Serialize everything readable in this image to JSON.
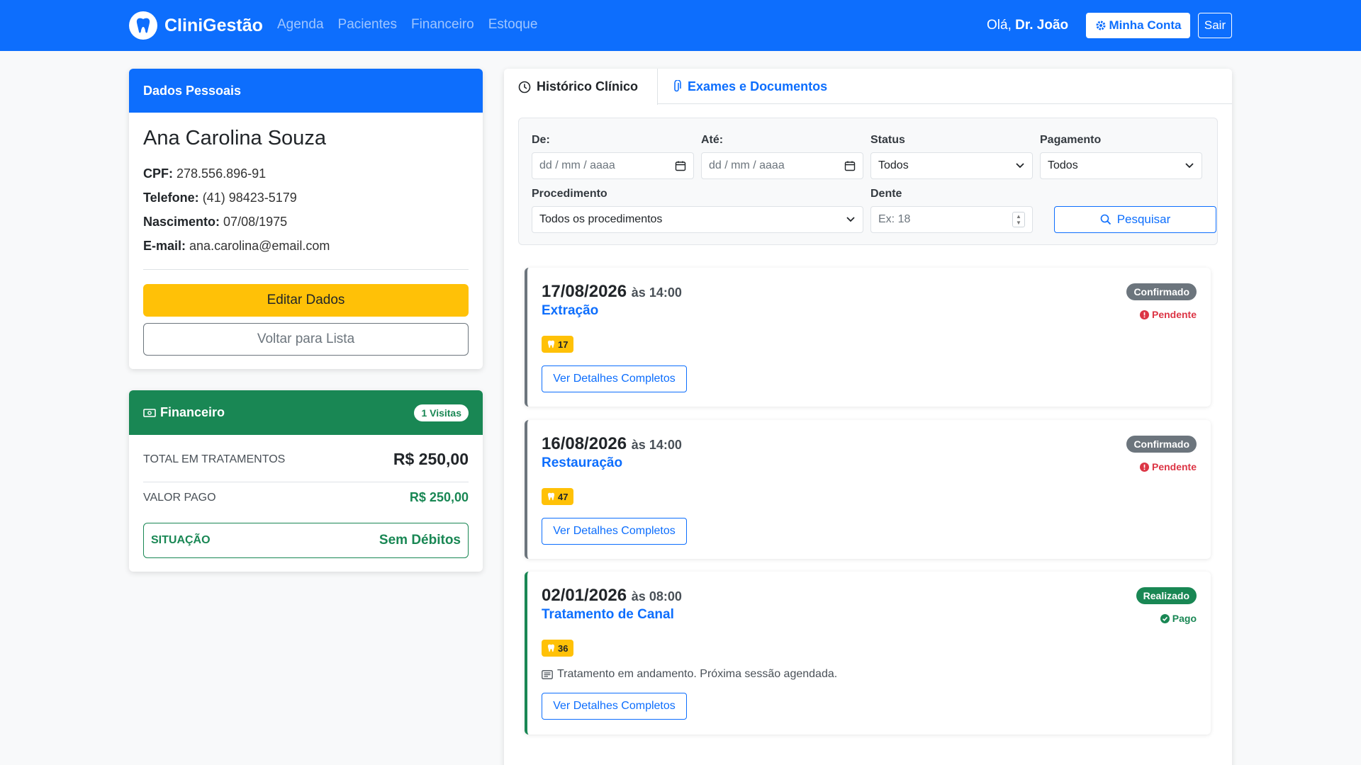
{
  "navbar": {
    "brand": "CliniGestão",
    "links": [
      "Agenda",
      "Pacientes",
      "Financeiro",
      "Estoque"
    ],
    "greeting_prefix": "Olá,",
    "user_name": "Dr. João",
    "account_label": "Minha Conta",
    "logout_label": "Sair",
    "brand_color": "#0d6efd"
  },
  "personal": {
    "header": "Dados Pessoais",
    "name": "Ana Carolina Souza",
    "cpf_label": "CPF:",
    "cpf": "278.556.896-91",
    "phone_label": "Telefone:",
    "phone": "(41) 98423-5179",
    "birth_label": "Nascimento:",
    "birth": "07/08/1975",
    "email_label": "E-mail:",
    "email": "ana.carolina@email.com",
    "edit_label": "Editar Dados",
    "back_label": "Voltar para Lista"
  },
  "finance": {
    "header": "Financeiro",
    "visits_badge": "1 Visitas",
    "total_label": "TOTAL EM TRATAMENTOS",
    "total_value": "R$ 250,00",
    "paid_label": "VALOR PAGO",
    "paid_value": "R$ 250,00",
    "situation_label": "SITUAÇÃO",
    "situation_value": "Sem Débitos",
    "color": "#198754"
  },
  "tabs": {
    "history": "Histórico Clínico",
    "exams": "Exames e Documentos"
  },
  "filters": {
    "from_label": "De:",
    "from_placeholder": "dd / mm / aaaa",
    "to_label": "Até:",
    "to_placeholder": "dd / mm / aaaa",
    "status_label": "Status",
    "status_value": "Todos",
    "payment_label": "Pagamento",
    "payment_value": "Todos",
    "procedure_label": "Procedimento",
    "procedure_value": "Todos os procedimentos",
    "tooth_label": "Dente",
    "tooth_placeholder": "Ex: 18",
    "search_label": "Pesquisar"
  },
  "appointments": [
    {
      "date": "17/08/2026",
      "time": "às 14:00",
      "procedure": "Extração",
      "tooth": "17",
      "status": "Confirmado",
      "payment": "Pendente",
      "details_label": "Ver Detalhes Completos"
    },
    {
      "date": "16/08/2026",
      "time": "às 14:00",
      "procedure": "Restauração",
      "tooth": "47",
      "status": "Confirmado",
      "payment": "Pendente",
      "details_label": "Ver Detalhes Completos"
    },
    {
      "date": "02/01/2026",
      "time": "às 08:00",
      "procedure": "Tratamento de Canal",
      "tooth": "36",
      "status": "Realizado",
      "payment": "Pago",
      "note": "Tratamento em andamento. Próxima sessão agendada.",
      "details_label": "Ver Detalhes Completos"
    }
  ]
}
